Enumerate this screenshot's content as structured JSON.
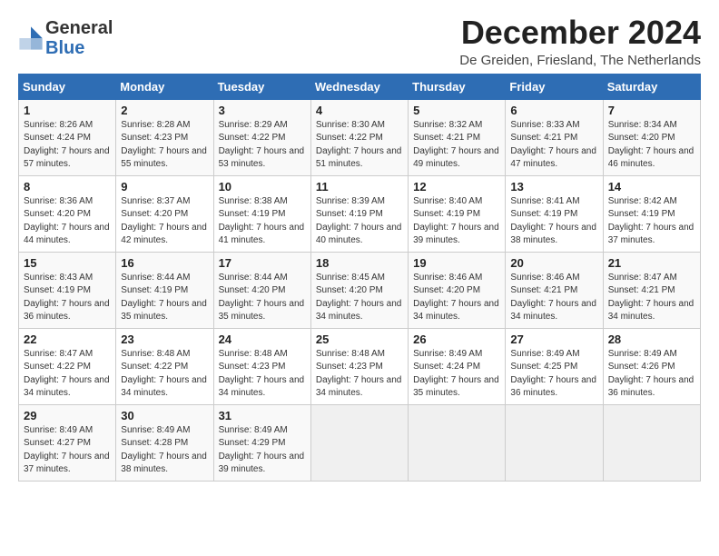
{
  "logo": {
    "general": "General",
    "blue": "Blue"
  },
  "title": "December 2024",
  "location": "De Greiden, Friesland, The Netherlands",
  "weekdays": [
    "Sunday",
    "Monday",
    "Tuesday",
    "Wednesday",
    "Thursday",
    "Friday",
    "Saturday"
  ],
  "weeks": [
    [
      {
        "day": 1,
        "sunrise": "Sunrise: 8:26 AM",
        "sunset": "Sunset: 4:24 PM",
        "daylight": "Daylight: 7 hours and 57 minutes."
      },
      {
        "day": 2,
        "sunrise": "Sunrise: 8:28 AM",
        "sunset": "Sunset: 4:23 PM",
        "daylight": "Daylight: 7 hours and 55 minutes."
      },
      {
        "day": 3,
        "sunrise": "Sunrise: 8:29 AM",
        "sunset": "Sunset: 4:22 PM",
        "daylight": "Daylight: 7 hours and 53 minutes."
      },
      {
        "day": 4,
        "sunrise": "Sunrise: 8:30 AM",
        "sunset": "Sunset: 4:22 PM",
        "daylight": "Daylight: 7 hours and 51 minutes."
      },
      {
        "day": 5,
        "sunrise": "Sunrise: 8:32 AM",
        "sunset": "Sunset: 4:21 PM",
        "daylight": "Daylight: 7 hours and 49 minutes."
      },
      {
        "day": 6,
        "sunrise": "Sunrise: 8:33 AM",
        "sunset": "Sunset: 4:21 PM",
        "daylight": "Daylight: 7 hours and 47 minutes."
      },
      {
        "day": 7,
        "sunrise": "Sunrise: 8:34 AM",
        "sunset": "Sunset: 4:20 PM",
        "daylight": "Daylight: 7 hours and 46 minutes."
      }
    ],
    [
      {
        "day": 8,
        "sunrise": "Sunrise: 8:36 AM",
        "sunset": "Sunset: 4:20 PM",
        "daylight": "Daylight: 7 hours and 44 minutes."
      },
      {
        "day": 9,
        "sunrise": "Sunrise: 8:37 AM",
        "sunset": "Sunset: 4:20 PM",
        "daylight": "Daylight: 7 hours and 42 minutes."
      },
      {
        "day": 10,
        "sunrise": "Sunrise: 8:38 AM",
        "sunset": "Sunset: 4:19 PM",
        "daylight": "Daylight: 7 hours and 41 minutes."
      },
      {
        "day": 11,
        "sunrise": "Sunrise: 8:39 AM",
        "sunset": "Sunset: 4:19 PM",
        "daylight": "Daylight: 7 hours and 40 minutes."
      },
      {
        "day": 12,
        "sunrise": "Sunrise: 8:40 AM",
        "sunset": "Sunset: 4:19 PM",
        "daylight": "Daylight: 7 hours and 39 minutes."
      },
      {
        "day": 13,
        "sunrise": "Sunrise: 8:41 AM",
        "sunset": "Sunset: 4:19 PM",
        "daylight": "Daylight: 7 hours and 38 minutes."
      },
      {
        "day": 14,
        "sunrise": "Sunrise: 8:42 AM",
        "sunset": "Sunset: 4:19 PM",
        "daylight": "Daylight: 7 hours and 37 minutes."
      }
    ],
    [
      {
        "day": 15,
        "sunrise": "Sunrise: 8:43 AM",
        "sunset": "Sunset: 4:19 PM",
        "daylight": "Daylight: 7 hours and 36 minutes."
      },
      {
        "day": 16,
        "sunrise": "Sunrise: 8:44 AM",
        "sunset": "Sunset: 4:19 PM",
        "daylight": "Daylight: 7 hours and 35 minutes."
      },
      {
        "day": 17,
        "sunrise": "Sunrise: 8:44 AM",
        "sunset": "Sunset: 4:20 PM",
        "daylight": "Daylight: 7 hours and 35 minutes."
      },
      {
        "day": 18,
        "sunrise": "Sunrise: 8:45 AM",
        "sunset": "Sunset: 4:20 PM",
        "daylight": "Daylight: 7 hours and 34 minutes."
      },
      {
        "day": 19,
        "sunrise": "Sunrise: 8:46 AM",
        "sunset": "Sunset: 4:20 PM",
        "daylight": "Daylight: 7 hours and 34 minutes."
      },
      {
        "day": 20,
        "sunrise": "Sunrise: 8:46 AM",
        "sunset": "Sunset: 4:21 PM",
        "daylight": "Daylight: 7 hours and 34 minutes."
      },
      {
        "day": 21,
        "sunrise": "Sunrise: 8:47 AM",
        "sunset": "Sunset: 4:21 PM",
        "daylight": "Daylight: 7 hours and 34 minutes."
      }
    ],
    [
      {
        "day": 22,
        "sunrise": "Sunrise: 8:47 AM",
        "sunset": "Sunset: 4:22 PM",
        "daylight": "Daylight: 7 hours and 34 minutes."
      },
      {
        "day": 23,
        "sunrise": "Sunrise: 8:48 AM",
        "sunset": "Sunset: 4:22 PM",
        "daylight": "Daylight: 7 hours and 34 minutes."
      },
      {
        "day": 24,
        "sunrise": "Sunrise: 8:48 AM",
        "sunset": "Sunset: 4:23 PM",
        "daylight": "Daylight: 7 hours and 34 minutes."
      },
      {
        "day": 25,
        "sunrise": "Sunrise: 8:48 AM",
        "sunset": "Sunset: 4:23 PM",
        "daylight": "Daylight: 7 hours and 34 minutes."
      },
      {
        "day": 26,
        "sunrise": "Sunrise: 8:49 AM",
        "sunset": "Sunset: 4:24 PM",
        "daylight": "Daylight: 7 hours and 35 minutes."
      },
      {
        "day": 27,
        "sunrise": "Sunrise: 8:49 AM",
        "sunset": "Sunset: 4:25 PM",
        "daylight": "Daylight: 7 hours and 36 minutes."
      },
      {
        "day": 28,
        "sunrise": "Sunrise: 8:49 AM",
        "sunset": "Sunset: 4:26 PM",
        "daylight": "Daylight: 7 hours and 36 minutes."
      }
    ],
    [
      {
        "day": 29,
        "sunrise": "Sunrise: 8:49 AM",
        "sunset": "Sunset: 4:27 PM",
        "daylight": "Daylight: 7 hours and 37 minutes."
      },
      {
        "day": 30,
        "sunrise": "Sunrise: 8:49 AM",
        "sunset": "Sunset: 4:28 PM",
        "daylight": "Daylight: 7 hours and 38 minutes."
      },
      {
        "day": 31,
        "sunrise": "Sunrise: 8:49 AM",
        "sunset": "Sunset: 4:29 PM",
        "daylight": "Daylight: 7 hours and 39 minutes."
      },
      null,
      null,
      null,
      null
    ]
  ]
}
